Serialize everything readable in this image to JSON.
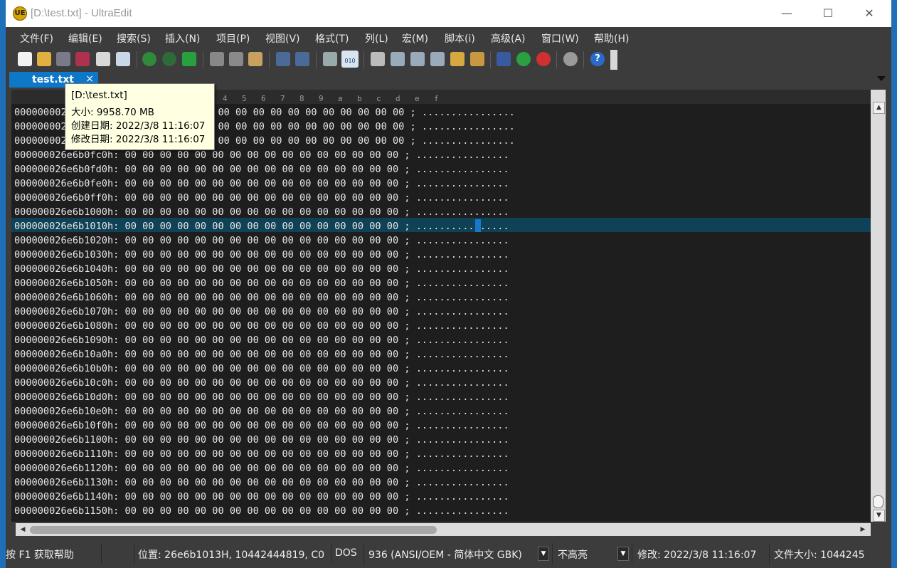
{
  "window": {
    "title": "[D:\\test.txt] - UltraEdit",
    "app_icon_text": "UE",
    "minimize": "—",
    "maximize": "☐",
    "close": "✕"
  },
  "menu": [
    "文件(F)",
    "编辑(E)",
    "搜索(S)",
    "插入(N)",
    "项目(P)",
    "视图(V)",
    "格式(T)",
    "列(L)",
    "宏(M)",
    "脚本(i)",
    "高级(A)",
    "窗口(W)",
    "帮助(H)"
  ],
  "toolbar": {
    "hex_button_label": "010",
    "help_glyph": "?",
    "icons": [
      "new-file-icon",
      "open-folder-icon",
      "save-icon",
      "save-all-icon",
      "print-icon",
      "print-preview-icon",
      "back-icon",
      "forward-icon",
      "goto-icon",
      "cut-icon",
      "copy-icon",
      "paste-icon",
      "undo-icon",
      "redo-icon",
      "column-mode-icon",
      "hex-mode-icon",
      "find-icon",
      "find-prev-icon",
      "find-next-icon",
      "replace-icon",
      "find-in-files-icon",
      "replace-in-files-icon",
      "ftp-icon",
      "compile-icon",
      "stop-icon",
      "gear-icon",
      "help-icon"
    ]
  },
  "tab": {
    "label": "test.txt",
    "close": "×"
  },
  "ruler": [
    "4",
    "5",
    "6",
    "7",
    "8",
    "9",
    "a",
    "b",
    "c",
    "d",
    "e",
    "f"
  ],
  "tooltip": {
    "path": "[D:\\test.txt]",
    "size": "大小: 9958.70 MB",
    "created": "创建日期: 2022/3/8 11:16:07",
    "modified": "修改日期: 2022/3/8 11:16:07"
  },
  "hex_bytes": "00 00 00 00 00 00 00 00 00 00 00 00 00 00 00 00",
  "ascii": "................",
  "current_row_index": 8,
  "rows": [
    "0000000026e6b0f90h",
    "0000000026e6b0fa0h",
    "0000000026e6b0fb0h",
    "000000026e6b0fc0h",
    "000000026e6b0fd0h",
    "000000026e6b0fe0h",
    "000000026e6b0ff0h",
    "000000026e6b1000h",
    "000000026e6b1010h",
    "000000026e6b1020h",
    "000000026e6b1030h",
    "000000026e6b1040h",
    "000000026e6b1050h",
    "000000026e6b1060h",
    "000000026e6b1070h",
    "000000026e6b1080h",
    "000000026e6b1090h",
    "000000026e6b10a0h",
    "000000026e6b10b0h",
    "000000026e6b10c0h",
    "000000026e6b10d0h",
    "000000026e6b10e0h",
    "000000026e6b10f0h",
    "000000026e6b1100h",
    "000000026e6b1110h",
    "000000026e6b1120h",
    "000000026e6b1130h",
    "000000026e6b1140h",
    "000000026e6b1150h"
  ],
  "status": {
    "help": "按 F1 获取帮助",
    "position": "位置: 26e6b1013H, 10442444819, C0",
    "line_ending": "DOS",
    "encoding": "936  (ANSI/OEM - 简体中文 GBK)",
    "highlight": "不高亮",
    "modified": "修改:   2022/3/8 11:16:07",
    "filesize": "文件大小:   1044245",
    "dropdown_glyph": "▼"
  },
  "colors": {
    "accent": "#0e78c8",
    "current_row": "#0f4256",
    "editor_bg": "#1e1e1e",
    "chrome": "#3c3c3c",
    "tooltip_bg": "#ffffe1"
  }
}
